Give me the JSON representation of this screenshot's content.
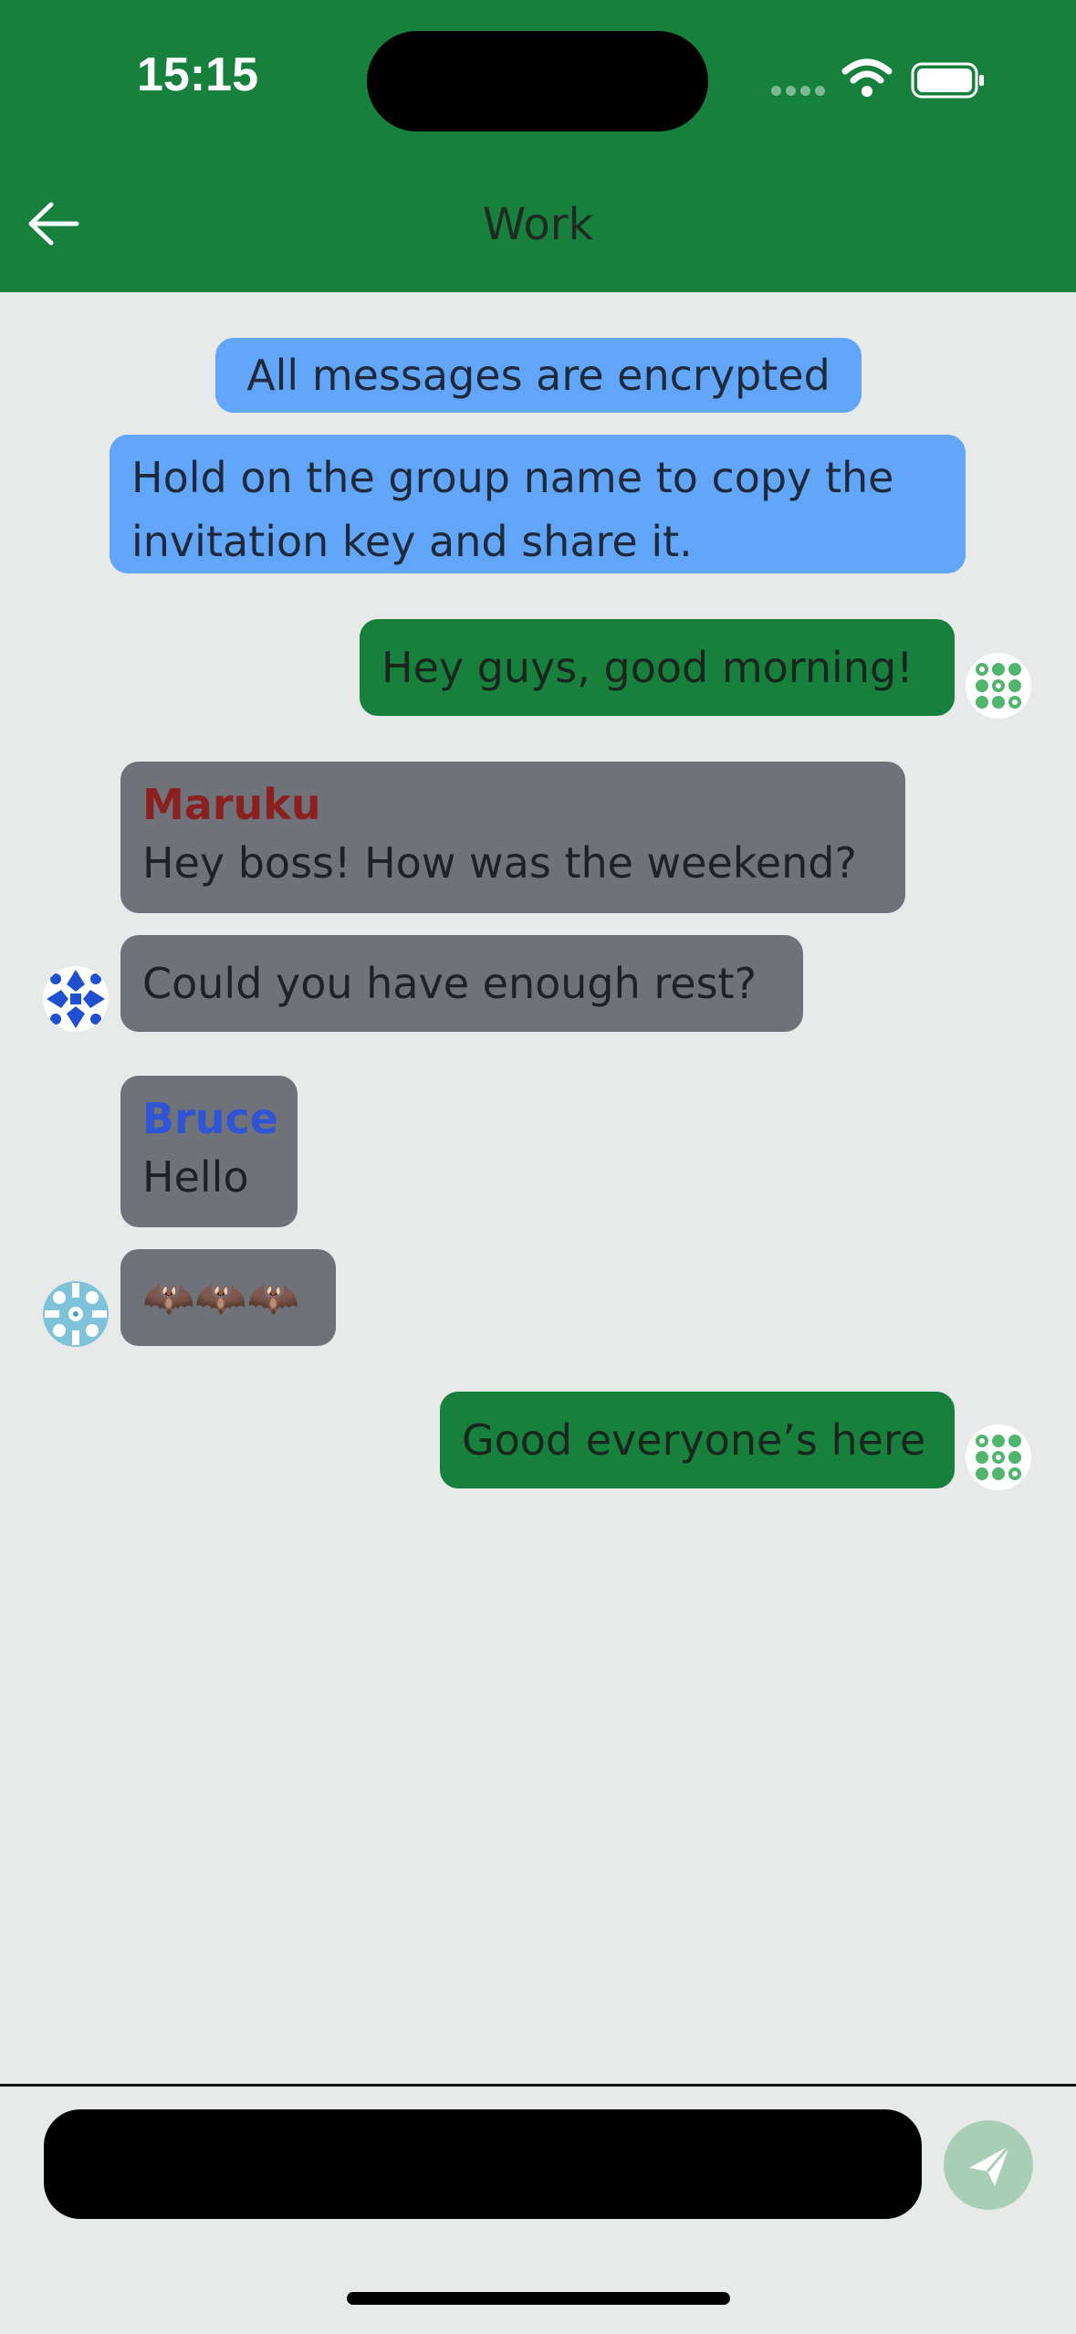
{
  "status_bar": {
    "time": "15:15"
  },
  "header": {
    "title": "Work"
  },
  "colors": {
    "header": "#17803c",
    "system_bubble": "#62a6fb",
    "my_bubble": "#17803c",
    "their_bubble": "#70727a",
    "maruku_name": "#8b2020",
    "bruce_name": "#2f55d4",
    "background": "#e8eaea"
  },
  "messages": {
    "system_1": {
      "text": "All messages are encrypted"
    },
    "system_2": {
      "text": "Hold on the group name to copy the invitation key and share it."
    },
    "mine_1": {
      "text": "Hey guys, good morning!"
    },
    "maruku_1": {
      "sender": "Maruku",
      "text": "Hey boss! How was the weekend?"
    },
    "maruku_2": {
      "text": "Could you have enough rest?"
    },
    "bruce_1": {
      "sender": "Bruce",
      "text": "Hello"
    },
    "bruce_2": {
      "text": "🦇🦇🦇"
    },
    "mine_2": {
      "text": "Good everyone’s here"
    }
  },
  "composer": {
    "placeholder": ""
  }
}
